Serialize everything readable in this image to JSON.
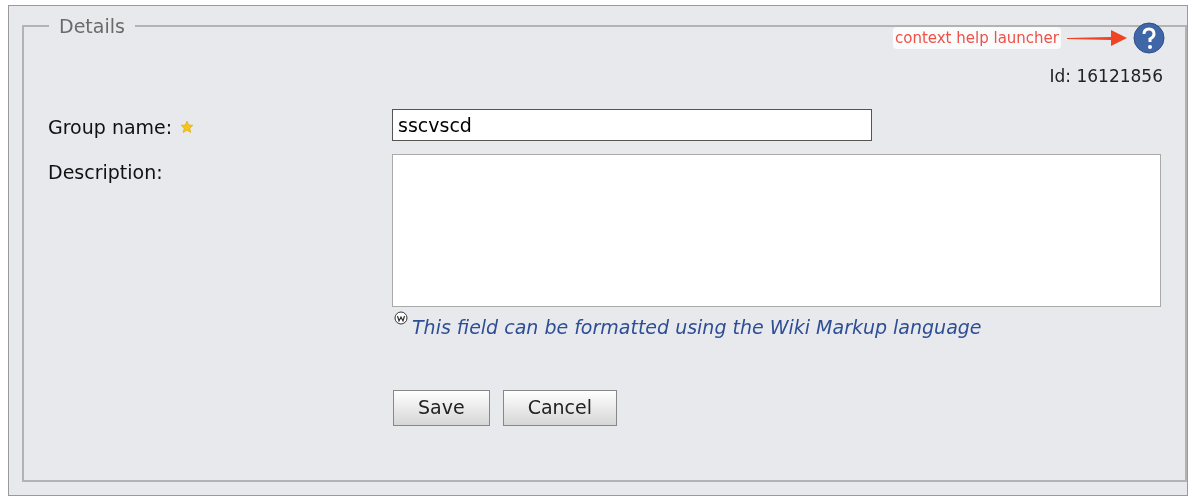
{
  "fieldset": {
    "legend": "Details"
  },
  "annotation": {
    "text": "context help launcher"
  },
  "record_id": "Id: 16121856",
  "fields": [
    {
      "kind": "text",
      "label": "Group name:",
      "required": true,
      "value": "sscvscd"
    },
    {
      "kind": "textarea",
      "label": "Description:",
      "required": false,
      "hint": "This field can be formatted using the Wiki Markup language"
    }
  ],
  "buttons": [
    "Save",
    "Cancel"
  ]
}
